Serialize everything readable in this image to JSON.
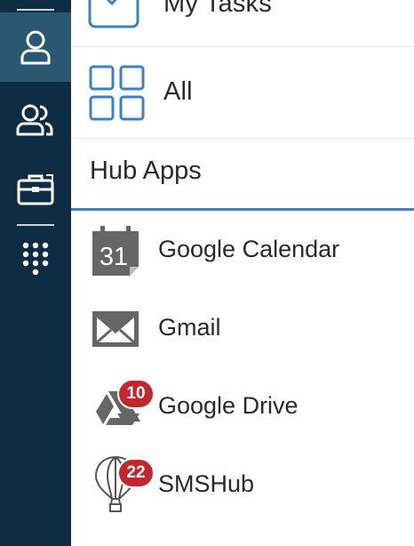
{
  "rail": {
    "items": [
      {
        "icon": "person-icon",
        "active": true
      },
      {
        "icon": "people-icon",
        "active": false
      },
      {
        "icon": "briefcase-icon",
        "active": false
      },
      {
        "icon": "dialpad-icon",
        "active": false
      }
    ]
  },
  "nav": {
    "my_tasks_label": "My Tasks",
    "all_label": "All"
  },
  "section": {
    "title": "Hub Apps"
  },
  "apps": [
    {
      "label": "Google Calendar",
      "icon": "calendar-icon",
      "icon_text": "31",
      "badge": null
    },
    {
      "label": "Gmail",
      "icon": "mail-icon",
      "badge": null
    },
    {
      "label": "Google Drive",
      "icon": "drive-icon",
      "badge": "10"
    },
    {
      "label": "SMSHub",
      "icon": "balloon-icon",
      "badge": "22"
    }
  ],
  "colors": {
    "rail_bg": "#0e2d45",
    "rail_active": "#2b5870",
    "accent": "#3b82c4",
    "badge": "#c1272d"
  }
}
